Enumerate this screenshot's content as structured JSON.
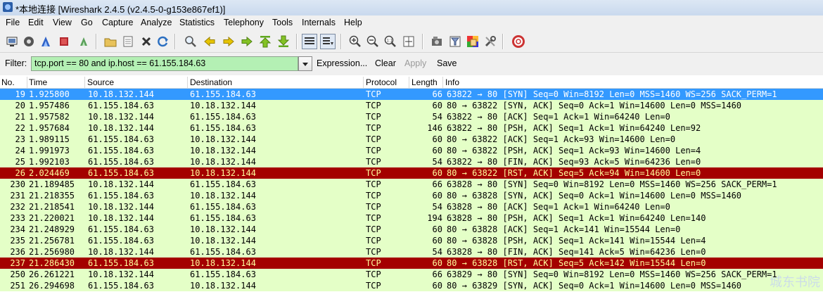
{
  "window": {
    "title": "*本地连接 [Wireshark 2.4.5 (v2.4.5-0-g153e867ef1)]"
  },
  "menu": [
    "File",
    "Edit",
    "View",
    "Go",
    "Capture",
    "Analyze",
    "Statistics",
    "Telephony",
    "Tools",
    "Internals",
    "Help"
  ],
  "toolbar": {
    "icons": [
      "interface-list-icon",
      "capture-options-icon",
      "start-capture-icon",
      "stop-capture-icon",
      "restart-capture-icon",
      "open-file-icon",
      "save-file-icon",
      "close-file-icon",
      "reload-icon",
      "find-packet-icon",
      "go-back-icon",
      "go-forward-icon",
      "go-to-packet-icon",
      "go-first-icon",
      "go-last-icon",
      "colorize-icon",
      "auto-scroll-icon",
      "zoom-in-icon",
      "zoom-out-icon",
      "zoom-normal-icon",
      "resize-columns-icon",
      "capture-filters-icon",
      "display-filters-icon",
      "coloring-rules-icon",
      "preferences-icon",
      "help-icon"
    ]
  },
  "filter": {
    "label": "Filter:",
    "value": "tcp.port == 80 and ip.host == 61.155.184.63",
    "expression": "Expression...",
    "clear": "Clear",
    "apply": "Apply",
    "save": "Save"
  },
  "columns": [
    "No.",
    "Time",
    "Source",
    "Destination",
    "Protocol",
    "Length",
    "Info"
  ],
  "packets": [
    {
      "no": "19",
      "time": "1.925800",
      "src": "10.18.132.144",
      "dst": "61.155.184.63",
      "proto": "TCP",
      "len": "66",
      "info": "63822 → 80 [SYN] Seq=0 Win=8192 Len=0 MSS=1460 WS=256 SACK_PERM=1",
      "color": "sel"
    },
    {
      "no": "20",
      "time": "1.957486",
      "src": "61.155.184.63",
      "dst": "10.18.132.144",
      "proto": "TCP",
      "len": "60",
      "info": "80 → 63822 [SYN, ACK] Seq=0 Ack=1 Win=14600 Len=0 MSS=1460",
      "color": "http"
    },
    {
      "no": "21",
      "time": "1.957582",
      "src": "10.18.132.144",
      "dst": "61.155.184.63",
      "proto": "TCP",
      "len": "54",
      "info": "63822 → 80 [ACK] Seq=1 Ack=1 Win=64240 Len=0",
      "color": "http"
    },
    {
      "no": "22",
      "time": "1.957684",
      "src": "10.18.132.144",
      "dst": "61.155.184.63",
      "proto": "TCP",
      "len": "146",
      "info": "63822 → 80 [PSH, ACK] Seq=1 Ack=1 Win=64240 Len=92",
      "color": "http"
    },
    {
      "no": "23",
      "time": "1.989115",
      "src": "61.155.184.63",
      "dst": "10.18.132.144",
      "proto": "TCP",
      "len": "60",
      "info": "80 → 63822 [ACK] Seq=1 Ack=93 Win=14600 Len=0",
      "color": "http"
    },
    {
      "no": "24",
      "time": "1.991973",
      "src": "61.155.184.63",
      "dst": "10.18.132.144",
      "proto": "TCP",
      "len": "60",
      "info": "80 → 63822 [PSH, ACK] Seq=1 Ack=93 Win=14600 Len=4",
      "color": "http"
    },
    {
      "no": "25",
      "time": "1.992103",
      "src": "61.155.184.63",
      "dst": "10.18.132.144",
      "proto": "TCP",
      "len": "54",
      "info": "63822 → 80 [FIN, ACK] Seq=93 Ack=5 Win=64236 Len=0",
      "color": "http"
    },
    {
      "no": "26",
      "time": "2.024469",
      "src": "61.155.184.63",
      "dst": "10.18.132.144",
      "proto": "TCP",
      "len": "60",
      "info": "80 → 63822 [RST, ACK] Seq=5 Ack=94 Win=14600 Len=0",
      "color": "rst"
    },
    {
      "no": "230",
      "time": "21.189485",
      "src": "10.18.132.144",
      "dst": "61.155.184.63",
      "proto": "TCP",
      "len": "66",
      "info": "63828 → 80 [SYN] Seq=0 Win=8192 Len=0 MSS=1460 WS=256 SACK_PERM=1",
      "color": "http"
    },
    {
      "no": "231",
      "time": "21.218355",
      "src": "61.155.184.63",
      "dst": "10.18.132.144",
      "proto": "TCP",
      "len": "60",
      "info": "80 → 63828 [SYN, ACK] Seq=0 Ack=1 Win=14600 Len=0 MSS=1460",
      "color": "http"
    },
    {
      "no": "232",
      "time": "21.218541",
      "src": "10.18.132.144",
      "dst": "61.155.184.63",
      "proto": "TCP",
      "len": "54",
      "info": "63828 → 80 [ACK] Seq=1 Ack=1 Win=64240 Len=0",
      "color": "http"
    },
    {
      "no": "233",
      "time": "21.220021",
      "src": "10.18.132.144",
      "dst": "61.155.184.63",
      "proto": "TCP",
      "len": "194",
      "info": "63828 → 80 [PSH, ACK] Seq=1 Ack=1 Win=64240 Len=140",
      "color": "http"
    },
    {
      "no": "234",
      "time": "21.248929",
      "src": "61.155.184.63",
      "dst": "10.18.132.144",
      "proto": "TCP",
      "len": "60",
      "info": "80 → 63828 [ACK] Seq=1 Ack=141 Win=15544 Len=0",
      "color": "http"
    },
    {
      "no": "235",
      "time": "21.256781",
      "src": "61.155.184.63",
      "dst": "10.18.132.144",
      "proto": "TCP",
      "len": "60",
      "info": "80 → 63828 [PSH, ACK] Seq=1 Ack=141 Win=15544 Len=4",
      "color": "http"
    },
    {
      "no": "236",
      "time": "21.256980",
      "src": "10.18.132.144",
      "dst": "61.155.184.63",
      "proto": "TCP",
      "len": "54",
      "info": "63828 → 80 [FIN, ACK] Seq=141 Ack=5 Win=64236 Len=0",
      "color": "http"
    },
    {
      "no": "237",
      "time": "21.286430",
      "src": "61.155.184.63",
      "dst": "10.18.132.144",
      "proto": "TCP",
      "len": "60",
      "info": "80 → 63828 [RST, ACK] Seq=5 Ack=142 Win=15544 Len=0",
      "color": "rst"
    },
    {
      "no": "250",
      "time": "26.261221",
      "src": "10.18.132.144",
      "dst": "61.155.184.63",
      "proto": "TCP",
      "len": "66",
      "info": "63829 → 80 [SYN] Seq=0 Win=8192 Len=0 MSS=1460 WS=256 SACK_PERM=1",
      "color": "http"
    },
    {
      "no": "251",
      "time": "26.294698",
      "src": "61.155.184.63",
      "dst": "10.18.132.144",
      "proto": "TCP",
      "len": "60",
      "info": "80 → 63829 [SYN, ACK] Seq=0 Ack=1 Win=14600 Len=0 MSS=1460",
      "color": "http"
    }
  ],
  "watermark": "城东书院"
}
